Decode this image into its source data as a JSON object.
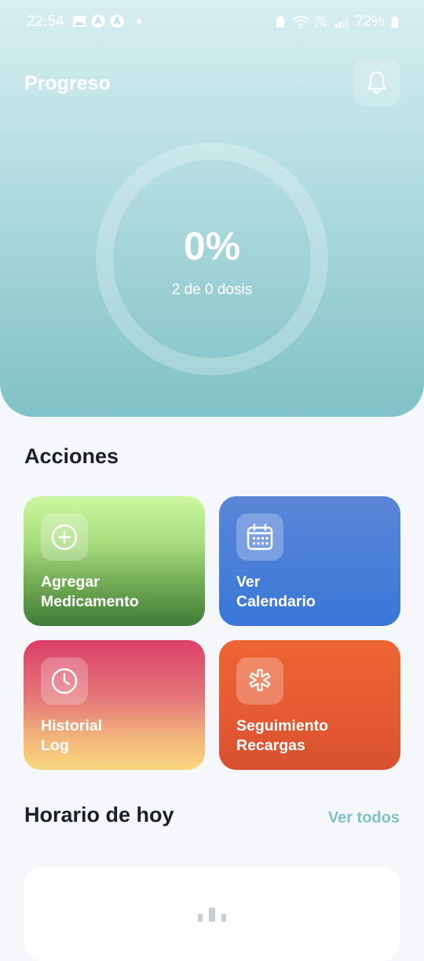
{
  "status_bar": {
    "time": "22:54",
    "battery": "72%",
    "network_label": "Vo) LTE"
  },
  "header": {
    "title": "Progreso",
    "progress_percent_label": "0%",
    "progress_fraction": 0,
    "doses_label": "2 de 0 dosis"
  },
  "actions": {
    "title": "Acciones",
    "items": [
      {
        "line1": "Agregar",
        "line2": "Medicamento",
        "icon": "plus-circle-icon"
      },
      {
        "line1": "Ver",
        "line2": "Calendario",
        "icon": "calendar-icon"
      },
      {
        "line1": "Historial",
        "line2": "Log",
        "icon": "clock-icon"
      },
      {
        "line1": "Seguimiento",
        "line2": "Recargas",
        "icon": "refill-asterisk-icon"
      }
    ]
  },
  "schedule": {
    "title": "Horario de hoy",
    "see_all": "Ver todos"
  },
  "colors": {
    "accent": "#7ec1c6",
    "header_top": "#d8eef0",
    "header_bottom": "#7fc2c7"
  }
}
